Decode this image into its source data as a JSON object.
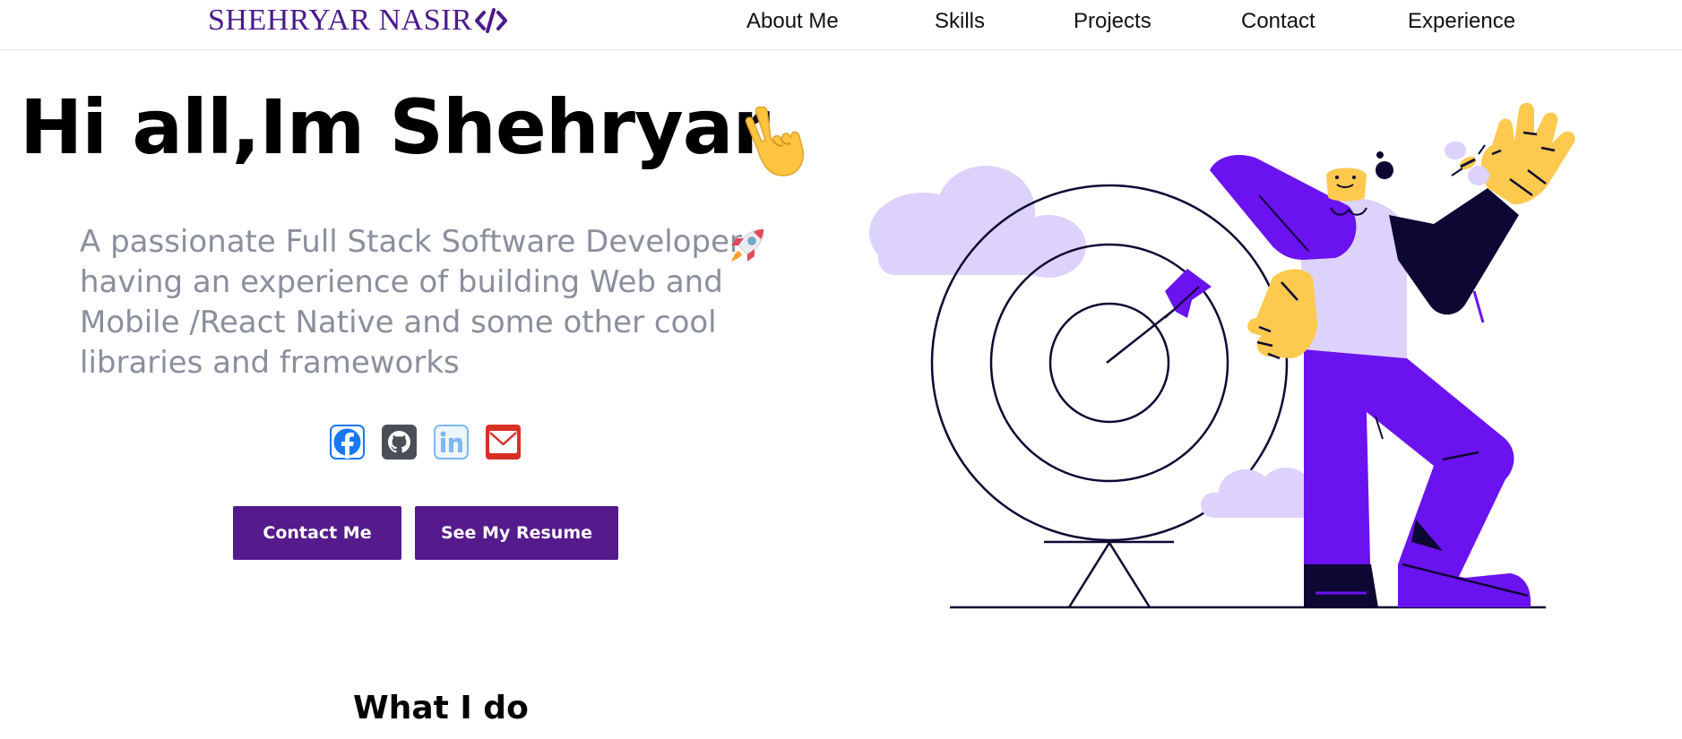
{
  "header": {
    "brand_name": "SHEHRYAR NASIR",
    "brand_icon": "code-brackets-icon",
    "nav": [
      {
        "label": "About Me"
      },
      {
        "label": "Skills"
      },
      {
        "label": "Projects"
      },
      {
        "label": "Contact"
      },
      {
        "label": "Experience"
      }
    ]
  },
  "hero": {
    "title": "Hi all,Im Shehryar",
    "title_emoji": "victory-hand-icon",
    "subtitle": "A passionate Full Stack Software Developer having an experience of building Web and Mobile /React Native and some other cool libraries and frameworks",
    "subtitle_emoji": "rocket-icon",
    "socials": [
      {
        "name": "facebook-icon",
        "color": "#1877f2"
      },
      {
        "name": "github-icon",
        "color": "#4a4f57"
      },
      {
        "name": "linkedin-icon",
        "color": "#7fb7ef"
      },
      {
        "name": "mail-icon",
        "color": "#d93025"
      }
    ],
    "buttons": {
      "contact": "Contact Me",
      "resume": "See My Resume"
    }
  },
  "sections": {
    "what_i_do": "What I do"
  },
  "colors": {
    "brand": "#4b1a8c",
    "button": "#551a8b",
    "subtitle": "#8a8f9c",
    "illustration_purple": "#6b12f0",
    "illustration_lavender": "#ddd2fb",
    "illustration_yellow": "#fdc94f",
    "illustration_navy": "#0d0833"
  }
}
